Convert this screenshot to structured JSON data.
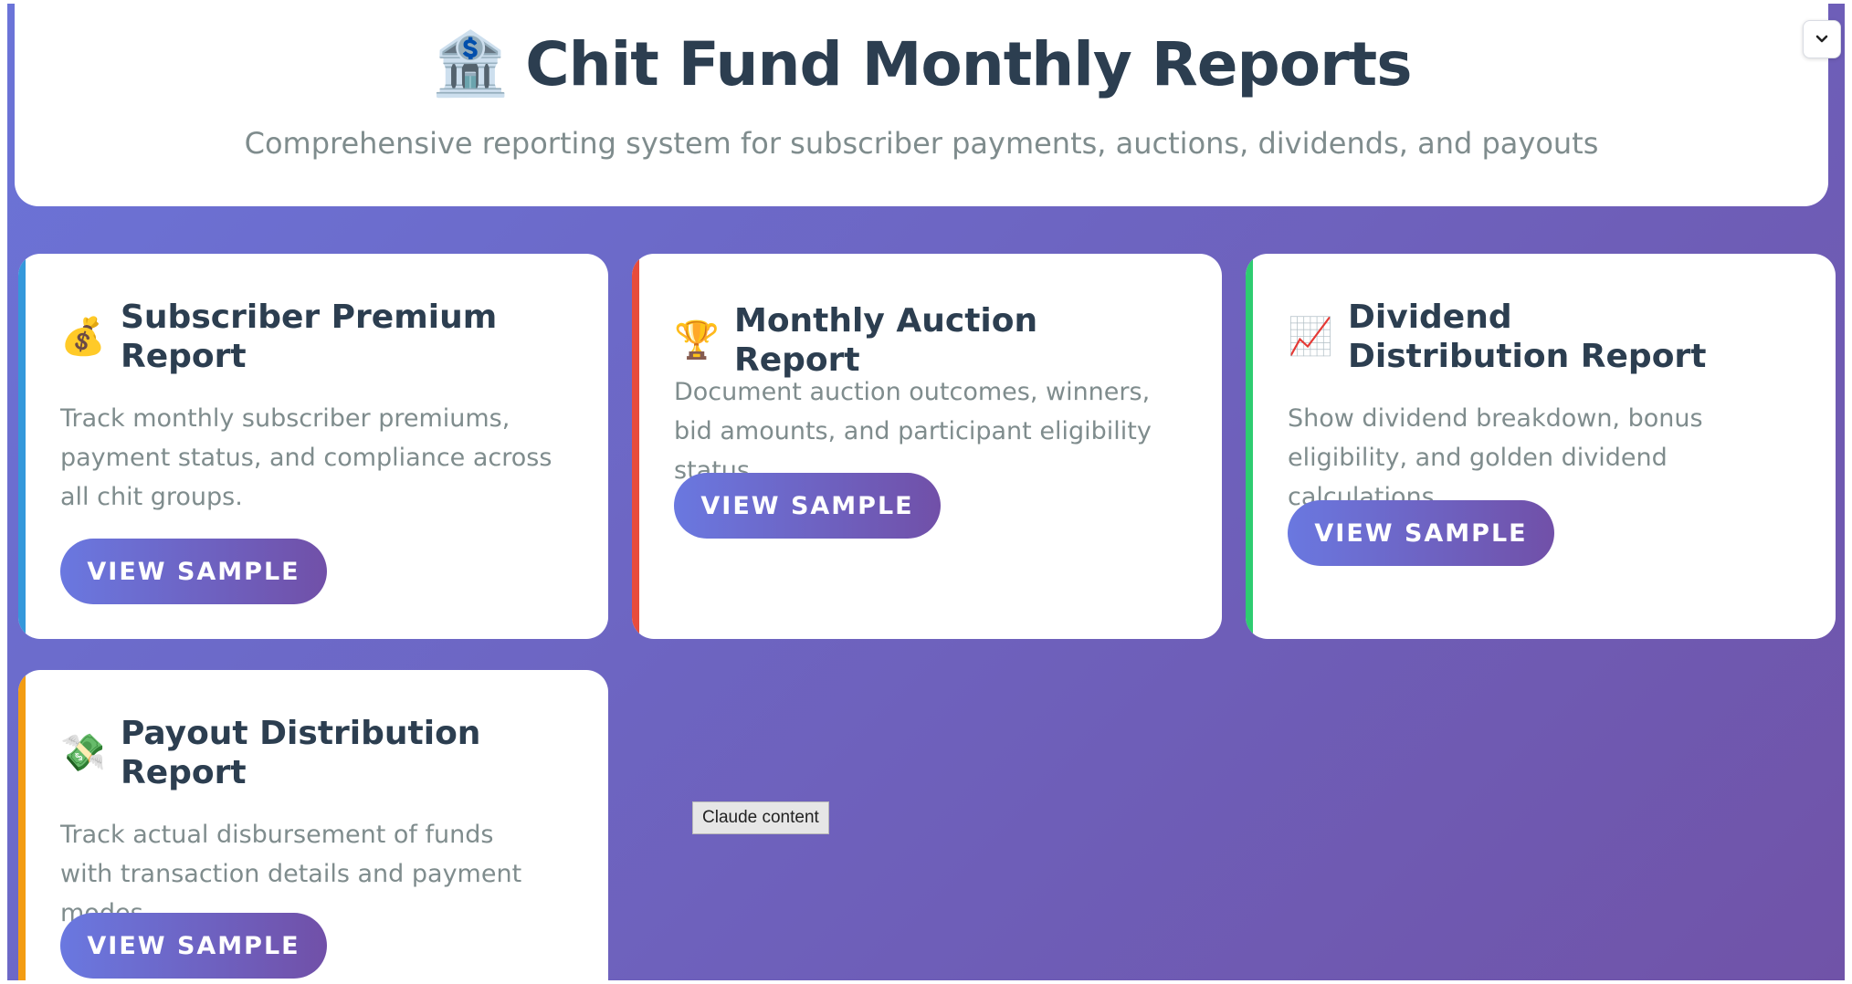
{
  "header": {
    "icon": "🏦",
    "title": "Chit Fund Monthly Reports",
    "subtitle": "Comprehensive reporting system for subscriber payments, auctions, dividends, and payouts"
  },
  "toolbar": {
    "collapse_icon": "chevron-down-icon"
  },
  "cards": [
    {
      "icon": "💰",
      "icon_name": "money-bag-icon",
      "title": "Subscriber Premium Report",
      "description": "Track monthly subscriber premiums, payment status, and compliance across all chit groups.",
      "button": "VIEW SAMPLE",
      "accent": "#3498db"
    },
    {
      "icon": "🏆",
      "icon_name": "trophy-icon",
      "title": "Monthly Auction Report",
      "description": "Document auction outcomes, winners, bid amounts, and participant eligibility status.",
      "button": "VIEW SAMPLE",
      "accent": "#e74c3c"
    },
    {
      "icon": "📈",
      "icon_name": "chart-increasing-icon",
      "title": "Dividend Distribution Report",
      "description": "Show dividend breakdown, bonus eligibility, and golden dividend calculations.",
      "button": "VIEW SAMPLE",
      "accent": "#2ecc71"
    },
    {
      "icon": "💸",
      "icon_name": "money-with-wings-icon",
      "title": "Payout Distribution Report",
      "description": "Track actual disbursement of funds with transaction details and payment modes.",
      "button": "VIEW SAMPLE",
      "accent": "#f39c12"
    }
  ],
  "tooltip": "Claude content",
  "colors": {
    "background_start": "#6b74d8",
    "background_end": "#7053a8",
    "title": "#2c3e50",
    "muted_text": "#7f8c8d"
  }
}
